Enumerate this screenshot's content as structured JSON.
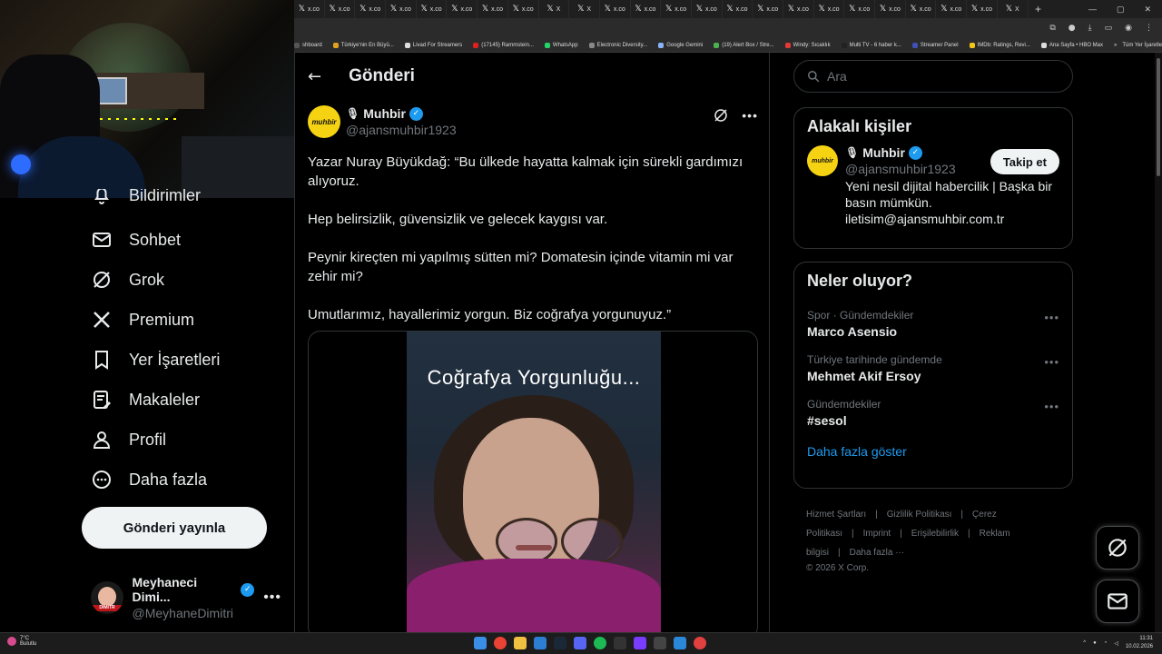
{
  "browser": {
    "tabs": [
      {
        "icon": "𝕏",
        "label": "x.co"
      },
      {
        "icon": "𝕏",
        "label": "x.co"
      },
      {
        "icon": "𝕏",
        "label": "x.co"
      },
      {
        "icon": "𝕏",
        "label": "x.co"
      },
      {
        "icon": "𝕏",
        "label": "x.co"
      },
      {
        "icon": "𝕏",
        "label": "x.co"
      },
      {
        "icon": "𝕏",
        "label": "x.co"
      },
      {
        "icon": "𝕏",
        "label": "x.co"
      },
      {
        "icon": "𝕏",
        "label": "X"
      },
      {
        "icon": "𝕏",
        "label": "X"
      },
      {
        "icon": "𝕏",
        "label": "x.co"
      },
      {
        "icon": "𝕏",
        "label": "x.co"
      },
      {
        "icon": "𝕏",
        "label": "x.co"
      },
      {
        "icon": "𝕏",
        "label": "x.co"
      },
      {
        "icon": "𝕏",
        "label": "x.co"
      },
      {
        "icon": "𝕏",
        "label": "x.co"
      },
      {
        "icon": "𝕏",
        "label": "x.co"
      },
      {
        "icon": "𝕏",
        "label": "x.co"
      },
      {
        "icon": "𝕏",
        "label": "x.co"
      },
      {
        "icon": "𝕏",
        "label": "x.co"
      },
      {
        "icon": "𝕏",
        "label": "x.co"
      },
      {
        "icon": "𝕏",
        "label": "x.co"
      },
      {
        "icon": "𝕏",
        "label": "x.co"
      },
      {
        "icon": "𝕏",
        "label": "X"
      }
    ],
    "bookmarks": [
      {
        "label": "shboard",
        "color": "#555"
      },
      {
        "label": "Türkiye'nin En Büyü...",
        "color": "#e0a020"
      },
      {
        "label": "Livad For Streamers",
        "color": "#ddd"
      },
      {
        "label": "(17145) Rammstein...",
        "color": "#e02020"
      },
      {
        "label": "WhatsApp",
        "color": "#25d366"
      },
      {
        "label": "Electronic Diversity...",
        "color": "#888"
      },
      {
        "label": "Google Gemini",
        "color": "#8ab4f8"
      },
      {
        "label": "(19) Alert Box / Stre...",
        "color": "#4caf50"
      },
      {
        "label": "Windy: Sıcaklık",
        "color": "#e53935"
      },
      {
        "label": "Multi TV - 6 haber k...",
        "color": "#222"
      },
      {
        "label": "Streamer Panel",
        "color": "#3f51b5"
      },
      {
        "label": "IMDb: Ratings, Revi...",
        "color": "#f5c518"
      },
      {
        "label": "Ana Sayfa • HBO Max",
        "color": "#ddd"
      }
    ],
    "bookmarks_end": "Tüm Yer İşaretleri"
  },
  "nav": {
    "items": [
      {
        "label": "Bildirimler",
        "icon": "bell-icon"
      },
      {
        "label": "Sohbet",
        "icon": "mail-icon"
      },
      {
        "label": "Grok",
        "icon": "grok-icon"
      },
      {
        "label": "Premium",
        "icon": "x-logo-icon"
      },
      {
        "label": "Yer İşaretleri",
        "icon": "bookmark-icon"
      },
      {
        "label": "Makaleler",
        "icon": "article-icon"
      },
      {
        "label": "Profil",
        "icon": "person-icon"
      },
      {
        "label": "Daha fazla",
        "icon": "more-circle-icon"
      }
    ],
    "post_button": "Gönderi yayınla",
    "account": {
      "name": "Meyhaneci Dimi...",
      "handle": "@MeyhaneDimitri",
      "avatar_tag": "DIMITR"
    }
  },
  "main": {
    "title": "Gönderi",
    "tweet": {
      "author_name": "Muhbir",
      "author_handle": "@ajansmuhbir1923",
      "avatar_text": "muhbir",
      "paragraphs": [
        "Yazar Nuray Büyükdağ: “Bu ülkede hayatta kalmak için sürekli gardımızı alıyoruz.",
        "Hep belirsizlik, güvensizlik ve gelecek kaygısı var.",
        "Peynir kireçten mi yapılmış sütten mi? Domatesin içinde vitamin mi var zehir mi?",
        "Umutlarımız, hayallerimiz yorgun. Biz coğrafya yorgunuyuz.”"
      ],
      "video_caption": "Coğrafya Yorgunluğu..."
    }
  },
  "right": {
    "search_placeholder": "Ara",
    "related": {
      "title": "Alakalı kişiler",
      "name": "Muhbir",
      "handle": "@ajansmuhbir1923",
      "bio": "Yeni nesil dijital habercilik | Başka bir basın mümkün. iletisim@ajansmuhbir.com.tr",
      "follow_label": "Takip et"
    },
    "trends": {
      "title": "Neler oluyor?",
      "items": [
        {
          "context": "Spor · Gündemdekiler",
          "name": "Marco Asensio"
        },
        {
          "context": "Türkiye tarihinde gündemde",
          "name": "Mehmet Akif Ersoy"
        },
        {
          "context": "Gündemdekiler",
          "name": "#sesol"
        }
      ],
      "show_more": "Daha fazla göster"
    },
    "footer": {
      "links": [
        "Hizmet Şartları",
        "|",
        "Gizlilik Politikası",
        "|",
        "Çerez Politikası",
        "|",
        "Imprint",
        "|",
        "Erişilebilirlik",
        "|",
        "Reklam bilgisi",
        "|",
        "Daha fazla ···"
      ],
      "copyright": "© 2026 X Corp."
    }
  },
  "taskbar": {
    "weather_temp": "7°C",
    "weather_text": "Bulutlu",
    "time": "11:31",
    "date": "10.02.2026"
  }
}
